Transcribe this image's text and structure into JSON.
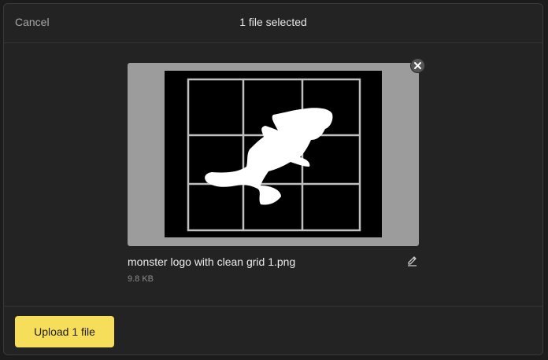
{
  "header": {
    "cancel_label": "Cancel",
    "title": "1 file selected"
  },
  "file": {
    "name": "monster logo with clean grid 1.png",
    "size": "9.8 KB",
    "thumbnail_bg": "#9c9c9c"
  },
  "icons": {
    "remove": "close-icon",
    "edit": "pencil-icon"
  },
  "footer": {
    "upload_label": "Upload 1 file",
    "accent_color": "#f7de5a"
  }
}
